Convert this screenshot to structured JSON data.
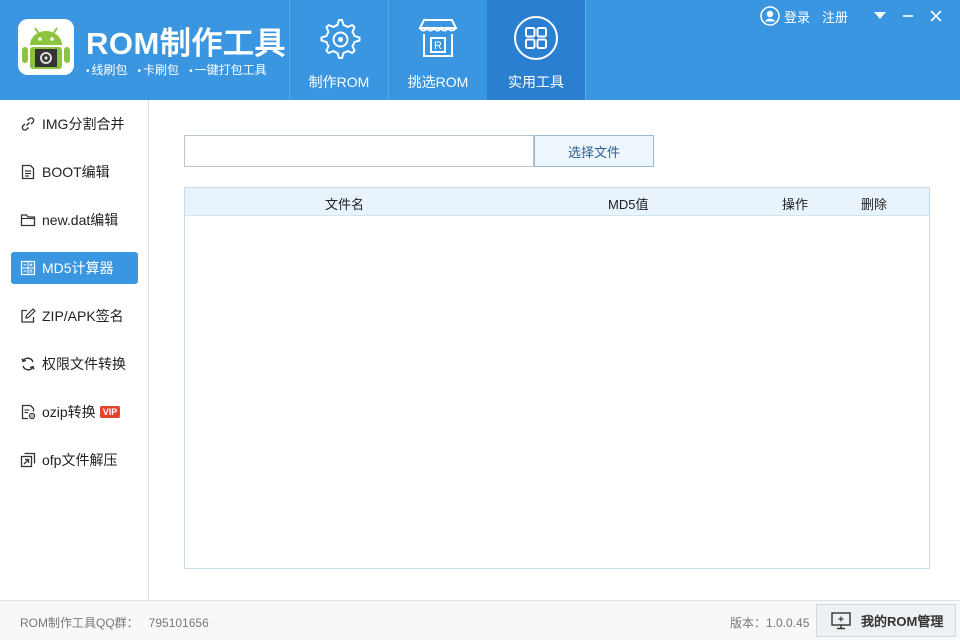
{
  "header": {
    "app_title": "ROM制作工具",
    "sub_items": [
      "线刷包",
      "卡刷包",
      "一键打包工具"
    ],
    "tabs": [
      {
        "label": "制作ROM",
        "icon": "gear-icon"
      },
      {
        "label": "挑选ROM",
        "icon": "store-icon"
      },
      {
        "label": "实用工具",
        "icon": "grid-icon",
        "active": true
      }
    ],
    "login": "登录",
    "register": "注册"
  },
  "sidebar": {
    "items": [
      {
        "label": "IMG分割合并",
        "icon": "link-icon"
      },
      {
        "label": "BOOT编辑",
        "icon": "document-icon"
      },
      {
        "label": "new.dat编辑",
        "icon": "folder-icon"
      },
      {
        "label": "MD5计算器",
        "icon": "calculator-icon",
        "active": true
      },
      {
        "label": "ZIP/APK签名",
        "icon": "edit-icon"
      },
      {
        "label": "权限文件转换",
        "icon": "refresh-icon"
      },
      {
        "label": "ozip转换",
        "icon": "file-settings-icon",
        "badge": "VIP"
      },
      {
        "label": "ofp文件解压",
        "icon": "extract-icon"
      }
    ]
  },
  "main": {
    "file_path": "",
    "choose_button": "选择文件",
    "table_headers": [
      "文件名",
      "MD5值",
      "操作",
      "删除"
    ]
  },
  "footer": {
    "qq_label": "ROM制作工具QQ群：",
    "qq_number": "795101656",
    "version": "版本：1.0.0.45",
    "rom_button": "我的ROM管理"
  },
  "colors": {
    "brand": "#3a96e0",
    "active_tab": "#2b7fd0",
    "vip": "#e8412c"
  }
}
